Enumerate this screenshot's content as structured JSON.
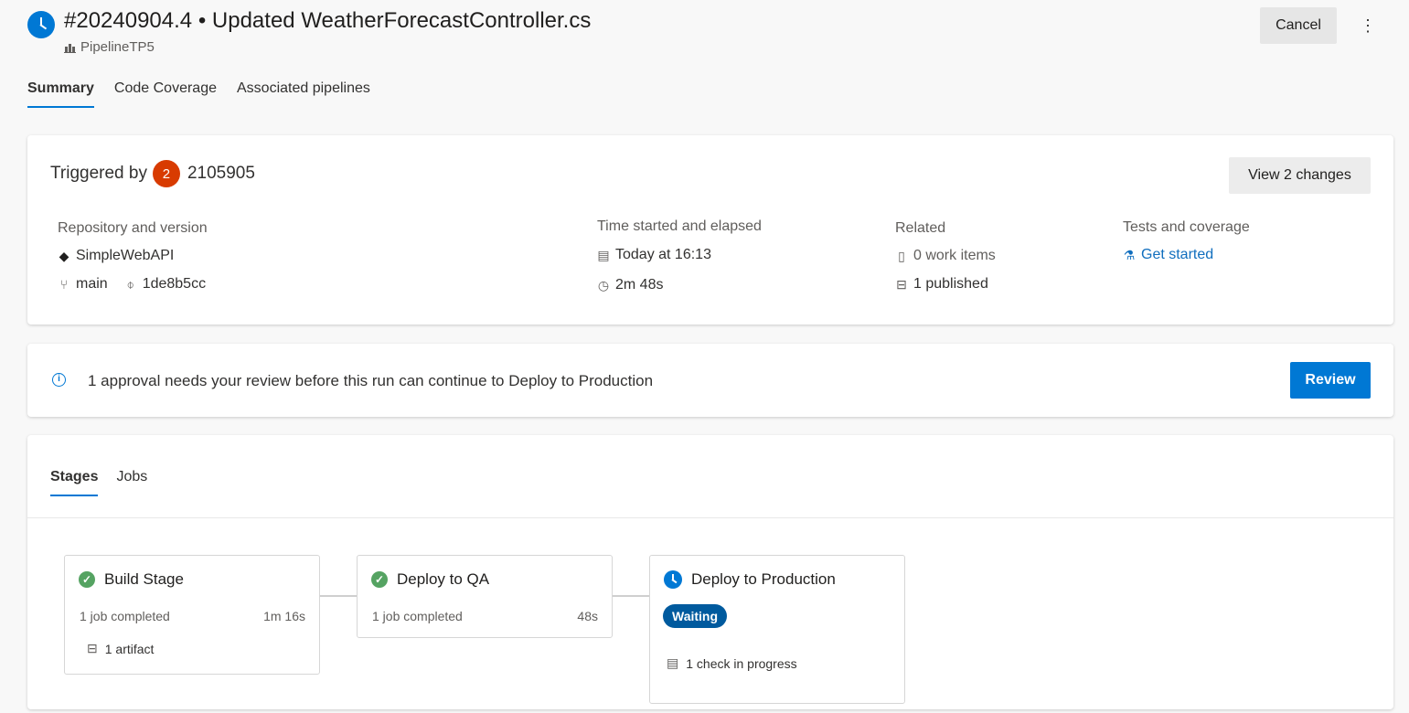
{
  "header": {
    "run_number": "#20240904.4",
    "separator": "•",
    "commit_message": "Updated WeatherForecastController.cs",
    "pipeline_name": "PipelineTP5",
    "cancel_label": "Cancel",
    "more_label": "⋮"
  },
  "tabs": [
    {
      "label": "Summary",
      "active": true
    },
    {
      "label": "Code Coverage",
      "active": false
    },
    {
      "label": "Associated pipelines",
      "active": false
    }
  ],
  "summary": {
    "triggered_by_label": "Triggered by",
    "user_avatar_initial": "2",
    "user_name": "2105905",
    "view_changes_label": "View 2 changes",
    "repository": {
      "label": "Repository and version",
      "name": "SimpleWebAPI",
      "branch": "main",
      "commit": "1de8b5cc"
    },
    "time": {
      "label": "Time started and elapsed",
      "started": "Today at 16:13",
      "elapsed": "2m 48s"
    },
    "related": {
      "label": "Related",
      "work_items": "0 work items",
      "published": "1 published"
    },
    "tests": {
      "label": "Tests and coverage",
      "link": "Get started"
    }
  },
  "approval": {
    "info_glyph": "i",
    "message": "1 approval needs your review before this run can continue to Deploy to Production",
    "review_label": "Review"
  },
  "stages_panel": {
    "tabs": [
      {
        "label": "Stages",
        "active": true
      },
      {
        "label": "Jobs",
        "active": false
      }
    ],
    "stages": [
      {
        "name": "Build Stage",
        "status": "succeeded",
        "status_glyph": "✓",
        "jobs": "1 job completed",
        "duration": "1m 16s",
        "artifacts": "1 artifact"
      },
      {
        "name": "Deploy to QA",
        "status": "succeeded",
        "status_glyph": "✓",
        "jobs": "1 job completed",
        "duration": "48s"
      },
      {
        "name": "Deploy to Production",
        "status": "waiting",
        "badge": "Waiting",
        "checks": "1 check in progress"
      }
    ]
  },
  "colors": {
    "accent": "#0078d4",
    "success": "#55a362",
    "avatar": "#d83b01",
    "waiting_badge": "#005a9e",
    "link": "#106ebe"
  }
}
